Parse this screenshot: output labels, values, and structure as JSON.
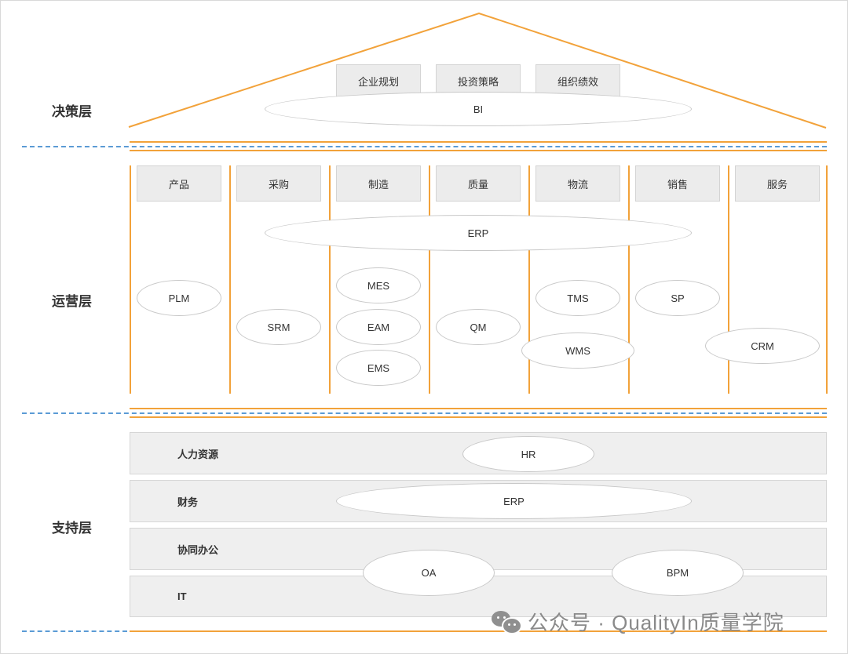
{
  "layers": {
    "decision": "决策层",
    "operation": "运营层",
    "support": "支持层"
  },
  "decision": {
    "boxes": [
      "企业规划",
      "投资策略",
      "组织绩效"
    ],
    "system": "BI"
  },
  "operation": {
    "domains": [
      "产品",
      "采购",
      "制造",
      "质量",
      "物流",
      "销售",
      "服务"
    ],
    "erp": "ERP",
    "systems": {
      "plm": "PLM",
      "srm": "SRM",
      "mes": "MES",
      "eam": "EAM",
      "ems": "EMS",
      "qm": "QM",
      "tms": "TMS",
      "wms": "WMS",
      "sp": "SP",
      "crm": "CRM"
    }
  },
  "support": {
    "rows": [
      "人力资源",
      "财务",
      "协同办公",
      "IT"
    ],
    "systems": {
      "hr": "HR",
      "erp": "ERP",
      "oa": "OA",
      "bpm": "BPM"
    }
  },
  "watermark": {
    "icon": "wechat-icon",
    "text": "公众号 · QualityIn质量学院"
  },
  "colors": {
    "frame_line": "#f2a23a",
    "separator_dash": "#5b9bd5",
    "box_fill": "#ececec"
  }
}
